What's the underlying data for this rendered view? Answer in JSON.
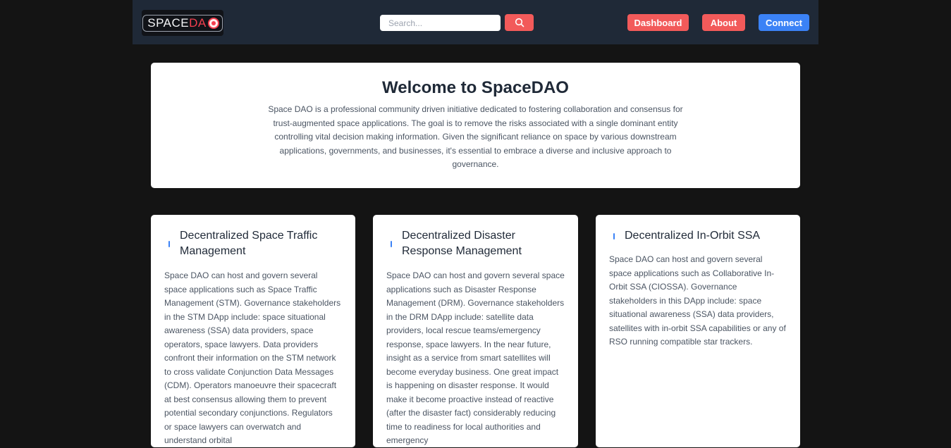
{
  "header": {
    "logo": {
      "text_main": "SPACE",
      "text_accent": "DA",
      "icon": "ring-logo-icon"
    },
    "search": {
      "placeholder": "Search...",
      "value": "",
      "icon": "search-icon"
    },
    "nav": {
      "dashboard_label": "Dashboard",
      "about_label": "About",
      "connect_label": "Connect"
    },
    "colors": {
      "bar_bg": "#1f2937",
      "accent_red": "#f25a5a",
      "accent_blue": "#3b82f6"
    }
  },
  "welcome": {
    "title": "Welcome to SpaceDAO",
    "body": "Space DAO is a professional community driven initiative dedicated to fostering collaboration and consensus for trust-augmented space applications. The goal is to remove the risks associated with a single dominant entity controlling vital decision making information. Given the significant reliance on space by various downstream applications, governments, and businesses, it's essential to embrace a diverse and inclusive approach to governance."
  },
  "cards": [
    {
      "icon": "satellite-icon",
      "title": "Decentralized Space Traffic Management",
      "body": "Space DAO can host and govern several space applications such as Space Traffic Management (STM). Governance stakeholders in the STM DApp include: space situational awareness (SSA) data providers, space operators, space lawyers. Data providers confront their information on the STM network to cross validate Conjunction Data Messages (CDM). Operators manoeuvre their spacecraft at best consensus allowing them to prevent potential secondary conjunctions. Regulators or space lawyers can overwatch and understand orbital"
    },
    {
      "icon": "satellite-icon",
      "title": "Decentralized Disaster Response Management",
      "body": "Space DAO can host and govern several space applications such as Disaster Response Management (DRM). Governance stakeholders in the DRM DApp include: satellite data providers, local rescue teams/emergency response, space lawyers. In the near future, insight as a service from smart satellites will become everyday business. One great impact is happening on disaster response. It would make it become proactive instead of reactive (after the disaster fact) considerably reducing time to readiness for local authorities and emergency"
    },
    {
      "icon": "satellite-icon",
      "title": "Decentralized In-Orbit SSA",
      "body": "Space DAO can host and govern several space applications such as Collaborative In-Orbit SSA (CIOSSA). Governance stakeholders in this DApp include: space situational awareness (SSA) data providers, satellites with in-orbit SSA capabilities or any of RSO running compatible star trackers."
    }
  ]
}
